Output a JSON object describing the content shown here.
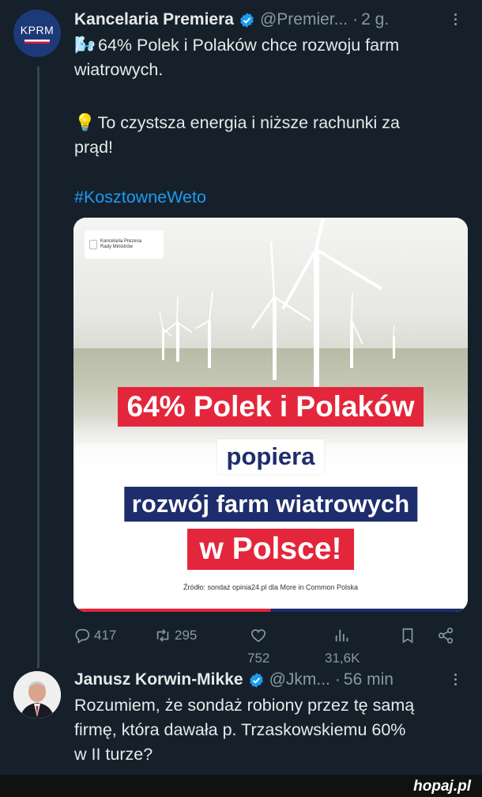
{
  "tweet1": {
    "author_name": "Kancelaria Premiera",
    "handle": "@Premier...",
    "time": "2 g.",
    "avatar_text": "KPRM",
    "lines": {
      "l1_emoji": "🌬️",
      "l1": "64% Polek i Polaków chce rozwoju farm",
      "l2": "wiatrowych.",
      "l3_emoji": "💡",
      "l3": "To czystsza energia i niższe rachunki za",
      "l4": "prąd!",
      "hashtag": "#KosztowneWeto"
    },
    "media": {
      "logo_line1": "Kancelaria Prezesa",
      "logo_line2": "Rady Ministrów",
      "banner1": "64% Polek i Polaków",
      "banner2": "popiera",
      "banner3": "rozwój farm wiatrowych",
      "banner4": "w Polsce!",
      "source": "Źródło: sondaż opinia24.pl dla More in Common Polska"
    },
    "actions": {
      "replies": "417",
      "retweets": "295",
      "likes": "752",
      "views": "31,6K"
    }
  },
  "tweet2": {
    "author_name": "Janusz Korwin-Mikke",
    "handle": "@Jkm...",
    "time": "56 min",
    "lines": {
      "l1": "Rozumiem, że sondaż robiony przez tę samą",
      "l2": "firmę, która dawała p. Trzaskowskiemu 60%",
      "l3": "w II turze?"
    }
  },
  "watermark": "hopaj.pl",
  "colors": {
    "background": "#15202b",
    "accent": "#1d9bf0",
    "muted": "#8b98a5",
    "banner_red": "#e3263b",
    "banner_navy": "#1e2d6b"
  }
}
